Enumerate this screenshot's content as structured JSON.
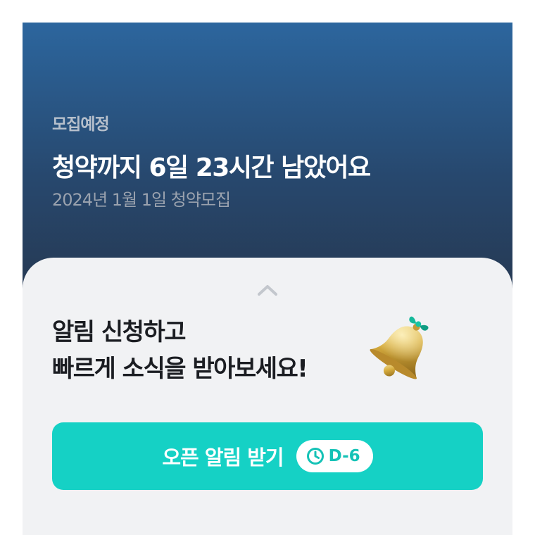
{
  "header": {
    "status_label": "모집예정",
    "countdown_title": "청약까지 6일 23시간 남았어요",
    "subscription_date": "2024년 1월 1일 청약모집"
  },
  "sheet": {
    "handle_icon": "chevron-up-icon",
    "promo_line1": "알림 신청하고",
    "promo_line2": "빠르게 소식을 받아보세요!",
    "bell_icon": "bell-icon"
  },
  "cta": {
    "label": "오픈 알림 받기",
    "dday_icon": "clock-icon",
    "dday": "D-6",
    "color": "#15d1c5"
  },
  "colors": {
    "header_top": "#2c669e",
    "header_bottom": "#262a32",
    "sheet_background": "#f1f2f4",
    "accent": "#15d1c5"
  }
}
